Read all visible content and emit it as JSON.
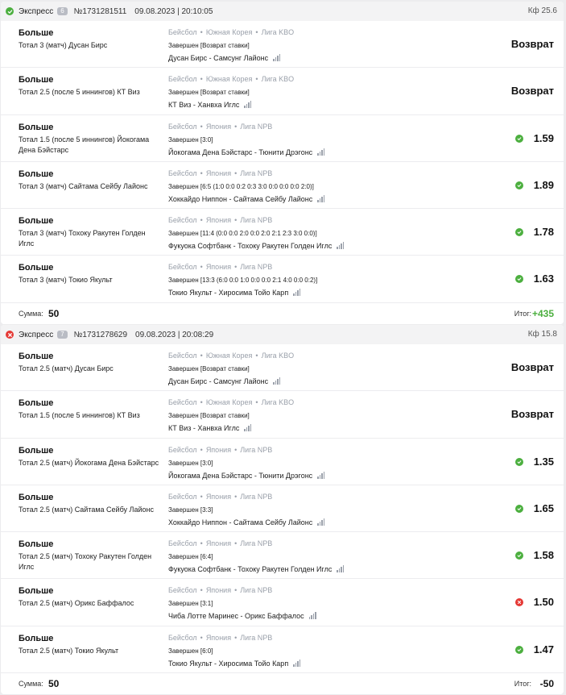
{
  "coupons": [
    {
      "status": "win",
      "type": "Экспресс",
      "count": "6",
      "number": "№1731281511",
      "date": "09.08.2023 | 20:10:05",
      "kf": "Кф 25.6",
      "stake_label": "Сумма:",
      "stake": "50",
      "total_label": "Итог:",
      "total": "+435",
      "events": [
        {
          "outcome": "Больше",
          "market": "Тотал 3 (матч) Дусан Бирс",
          "sport": "Бейсбол",
          "country": "Южная Корея",
          "league": "Лига KBO",
          "result": "Завершен [Возврат ставки]",
          "match": "Дусан Бирс - Самсунг Лайонс",
          "odds": "Возврат",
          "icon": "none"
        },
        {
          "outcome": "Больше",
          "market": "Тотал 2.5 (после 5 иннингов) КТ Виз",
          "sport": "Бейсбол",
          "country": "Южная Корея",
          "league": "Лига KBO",
          "result": "Завершен [Возврат ставки]",
          "match": "КТ Виз - Ханвха Иглс",
          "odds": "Возврат",
          "icon": "none"
        },
        {
          "outcome": "Больше",
          "market": "Тотал 1.5 (после 5 иннингов) Йокогама Дена Бэйстарс",
          "sport": "Бейсбол",
          "country": "Япония",
          "league": "Лига NPB",
          "result": "Завершен [3:0]",
          "match": "Йокогама Дена Бэйстарс - Тюнити Дрэгонс",
          "odds": "1.59",
          "icon": "win"
        },
        {
          "outcome": "Больше",
          "market": "Тотал 3 (матч) Сайтама Сейбу Лайонс",
          "sport": "Бейсбол",
          "country": "Япония",
          "league": "Лига NPB",
          "result": "Завершен [6:5 (1:0 0:0 0:2 0:3 3:0 0:0 0:0 0:0 2:0)]",
          "match": "Хоккайдо Ниппон - Сайтама Сейбу Лайонс",
          "odds": "1.89",
          "icon": "win"
        },
        {
          "outcome": "Больше",
          "market": "Тотал 3 (матч) Тохоку Ракутен Голден Иглс",
          "sport": "Бейсбол",
          "country": "Япония",
          "league": "Лига NPB",
          "result": "Завершен [11:4 (0:0 0:0 2:0 0:0 2:0 2:1 2:3 3:0 0:0)]",
          "match": "Фукуока Софтбанк - Тохоку Ракутен Голден Иглс",
          "odds": "1.78",
          "icon": "win"
        },
        {
          "outcome": "Больше",
          "market": "Тотал 3 (матч) Токио Якульт",
          "sport": "Бейсбол",
          "country": "Япония",
          "league": "Лига NPB",
          "result": "Завершен [13:3 (6:0 0:0 1:0 0:0 0:0 2:1 4:0 0:0 0:2)]",
          "match": "Токио Якульт - Хиросима Тойо Карп",
          "odds": "1.63",
          "icon": "win"
        }
      ]
    },
    {
      "status": "loss",
      "type": "Экспресс",
      "count": "7",
      "number": "№1731278629",
      "date": "09.08.2023 | 20:08:29",
      "kf": "Кф 15.8",
      "stake_label": "Сумма:",
      "stake": "50",
      "total_label": "Итог:",
      "total": "-50",
      "events": [
        {
          "outcome": "Больше",
          "market": "Тотал 2.5 (матч) Дусан Бирс",
          "sport": "Бейсбол",
          "country": "Южная Корея",
          "league": "Лига KBO",
          "result": "Завершен [Возврат ставки]",
          "match": "Дусан Бирс - Самсунг Лайонс",
          "odds": "Возврат",
          "icon": "none"
        },
        {
          "outcome": "Больше",
          "market": "Тотал 1.5 (после 5 иннингов) КТ Виз",
          "sport": "Бейсбол",
          "country": "Южная Корея",
          "league": "Лига KBO",
          "result": "Завершен [Возврат ставки]",
          "match": "КТ Виз - Ханвха Иглс",
          "odds": "Возврат",
          "icon": "none"
        },
        {
          "outcome": "Больше",
          "market": "Тотал 2.5 (матч) Йокогама Дена Бэйстарс",
          "sport": "Бейсбол",
          "country": "Япония",
          "league": "Лига NPB",
          "result": "Завершен [3:0]",
          "match": "Йокогама Дена Бэйстарс - Тюнити Дрэгонс",
          "odds": "1.35",
          "icon": "win"
        },
        {
          "outcome": "Больше",
          "market": "Тотал 2.5 (матч) Сайтама Сейбу Лайонс",
          "sport": "Бейсбол",
          "country": "Япония",
          "league": "Лига NPB",
          "result": "Завершен [3:3]",
          "match": "Хоккайдо Ниппон - Сайтама Сейбу Лайонс",
          "odds": "1.65",
          "icon": "win"
        },
        {
          "outcome": "Больше",
          "market": "Тотал 2.5 (матч) Тохоку Ракутен Голден Иглс",
          "sport": "Бейсбол",
          "country": "Япония",
          "league": "Лига NPB",
          "result": "Завершен [6:4]",
          "match": "Фукуока Софтбанк - Тохоку Ракутен Голден Иглс",
          "odds": "1.58",
          "icon": "win"
        },
        {
          "outcome": "Больше",
          "market": "Тотал 2.5 (матч) Орикс Баффалос",
          "sport": "Бейсбол",
          "country": "Япония",
          "league": "Лига NPB",
          "result": "Завершен [3:1]",
          "match": "Чиба Лотте Маринес - Орикс Баффалос",
          "odds": "1.50",
          "icon": "loss"
        },
        {
          "outcome": "Больше",
          "market": "Тотал 2.5 (матч) Токио Якульт",
          "sport": "Бейсбол",
          "country": "Япония",
          "league": "Лига NPB",
          "result": "Завершен [6:0]",
          "match": "Токио Якульт - Хиросима Тойо Карп",
          "odds": "1.47",
          "icon": "win"
        }
      ]
    }
  ],
  "colors": {
    "win": "#4caf3f",
    "loss": "#e53935",
    "meta": "#9aa0aa"
  },
  "icons": {
    "win": "checkmark-icon",
    "loss": "cross-icon",
    "stats": "stats-bars-icon"
  }
}
